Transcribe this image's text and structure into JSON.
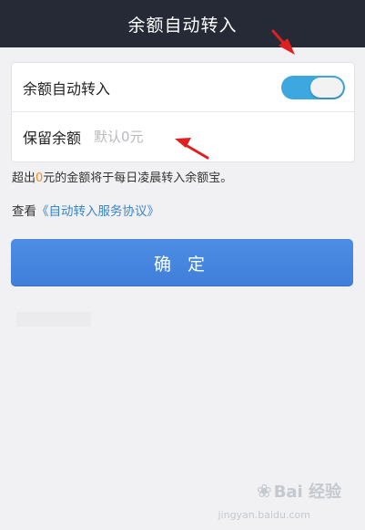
{
  "nav": {
    "title": "余额自动转入"
  },
  "settings": {
    "auto_transfer_label": "余额自动转入",
    "auto_transfer_on": true,
    "reserve_label": "保留余额",
    "reserve_placeholder": "默认0元"
  },
  "description": {
    "prefix": "超出",
    "amount": "0",
    "suffix": "元的金额将于每日凌晨转入余额宝。"
  },
  "agreement": {
    "prefix": "查看",
    "link": "《自动转入服务协议》"
  },
  "confirm_label": "确 定",
  "watermark": {
    "brand": "Bai 经验",
    "url": "jingyan.baidu.com"
  },
  "colors": {
    "nav_bg": "#252a36",
    "toggle_on": "#3da7e0",
    "button": "#4585de",
    "highlight": "#f28b1e",
    "link": "#3a86c7",
    "arrow": "#e02020"
  }
}
